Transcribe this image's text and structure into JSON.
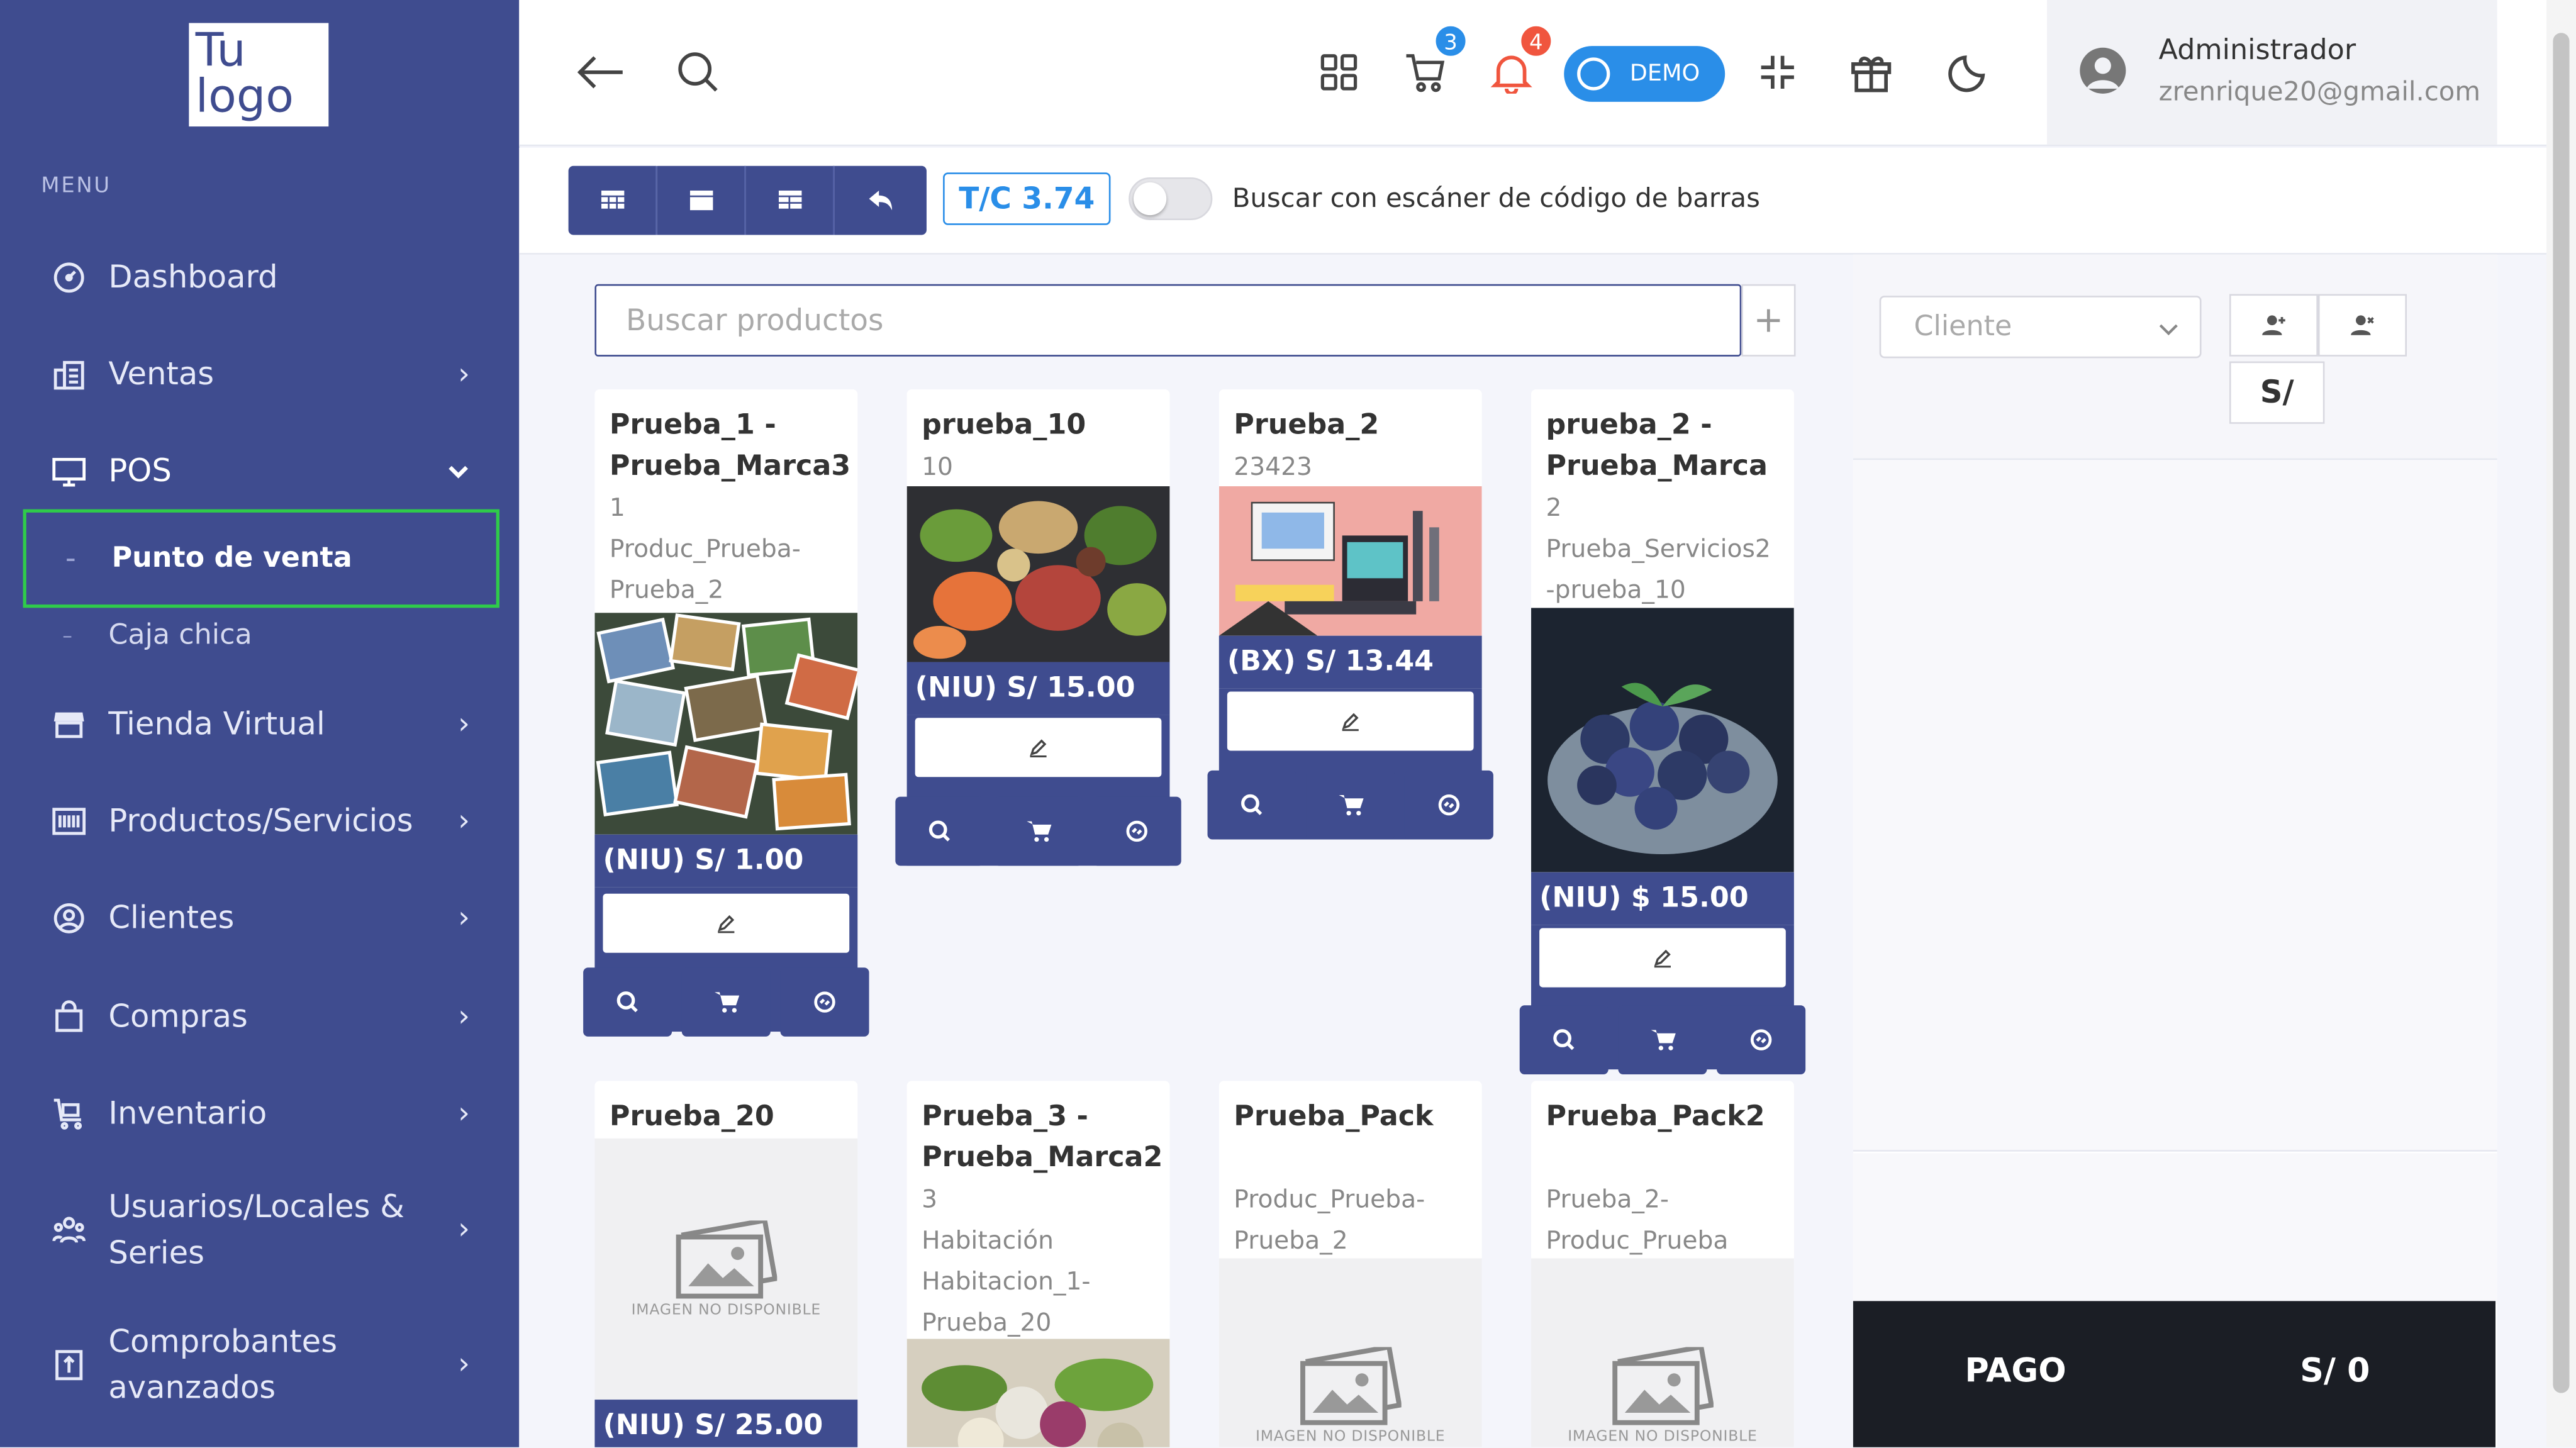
{
  "app": {
    "logo_line1": "Tu",
    "logo_line2": "logo",
    "accent_color": "#3f4c8f",
    "active_outline_color": "#2fcc4a"
  },
  "sidebar": {
    "menu_label": "MENU",
    "items": [
      {
        "label": "Dashboard",
        "icon": "gauge-icon",
        "has_children": false
      },
      {
        "label": "Ventas",
        "icon": "ledger-icon",
        "has_children": true
      },
      {
        "label": "POS",
        "icon": "monitor-icon",
        "has_children": true,
        "expanded": true
      },
      {
        "label": "Tienda Virtual",
        "icon": "store-icon",
        "has_children": true
      },
      {
        "label": "Productos/Servicios",
        "icon": "barcode-icon",
        "has_children": true
      },
      {
        "label": "Clientes",
        "icon": "user-circle-icon",
        "has_children": true
      },
      {
        "label": "Compras",
        "icon": "bag-icon",
        "has_children": true
      },
      {
        "label": "Inventario",
        "icon": "cart-loaded-icon",
        "has_children": true
      },
      {
        "label": "Usuarios/Locales & Series",
        "icon": "users-icon",
        "has_children": true
      },
      {
        "label": "Comprobantes avanzados",
        "icon": "invoice-icon",
        "has_children": true
      }
    ],
    "pos_children": [
      {
        "label": "Punto de venta",
        "selected": true
      },
      {
        "label": "Caja chica",
        "selected": false
      }
    ]
  },
  "header": {
    "cart_count": "3",
    "notifications_count": "4",
    "demo_label": "DEMO",
    "user_name": "Administrador",
    "user_email": "zrenrique20@gmail.com"
  },
  "toolbar": {
    "exchange_rate": "T/C 3.74",
    "barcode_scan_label": "Buscar con escáner de código de barras",
    "barcode_scan_enabled": false
  },
  "products": {
    "search_placeholder": "Buscar productos",
    "no_image_caption": "IMAGEN NO DISPONIBLE",
    "items": [
      {
        "name": "Prueba_1 - Prueba_Marca3",
        "lines": [
          "1",
          "Produc_Prueba-",
          "Prueba_2"
        ],
        "price": "(NIU) S/ 1.00",
        "image": "photo-collage"
      },
      {
        "name": "prueba_10",
        "lines": [
          "10"
        ],
        "price": "(NIU) S/ 15.00",
        "image": "food-spread"
      },
      {
        "name": "Prueba_2",
        "lines": [
          "23423"
        ],
        "price": "(BX) S/ 13.44",
        "image": "desk-illustration"
      },
      {
        "name": "prueba_2 - Prueba_Marca",
        "lines": [
          "2",
          "Prueba_Servicios2",
          "-prueba_10"
        ],
        "price": "(NIU) $ 15.00",
        "image": "blueberries"
      },
      {
        "name": "Prueba_20",
        "lines": [],
        "price": "(NIU) S/ 25.00",
        "image": "none"
      },
      {
        "name": "Prueba_3 - Prueba_Marca2",
        "lines": [
          "3",
          "Habitación",
          "Habitacion_1-",
          "Prueba_20"
        ],
        "price": "",
        "image": "vegetables"
      },
      {
        "name": "Prueba_Pack",
        "lines": [
          "",
          "Produc_Prueba-",
          "Prueba_2"
        ],
        "price": "",
        "image": "none"
      },
      {
        "name": "Prueba_Pack2",
        "lines": [
          "",
          "Prueba_2-",
          "Produc_Prueba"
        ],
        "price": "",
        "image": "none"
      }
    ]
  },
  "right_panel": {
    "client_placeholder": "Cliente",
    "currency_symbol": "S/",
    "pay_label": "PAGO",
    "pay_total": "S/ 0"
  }
}
